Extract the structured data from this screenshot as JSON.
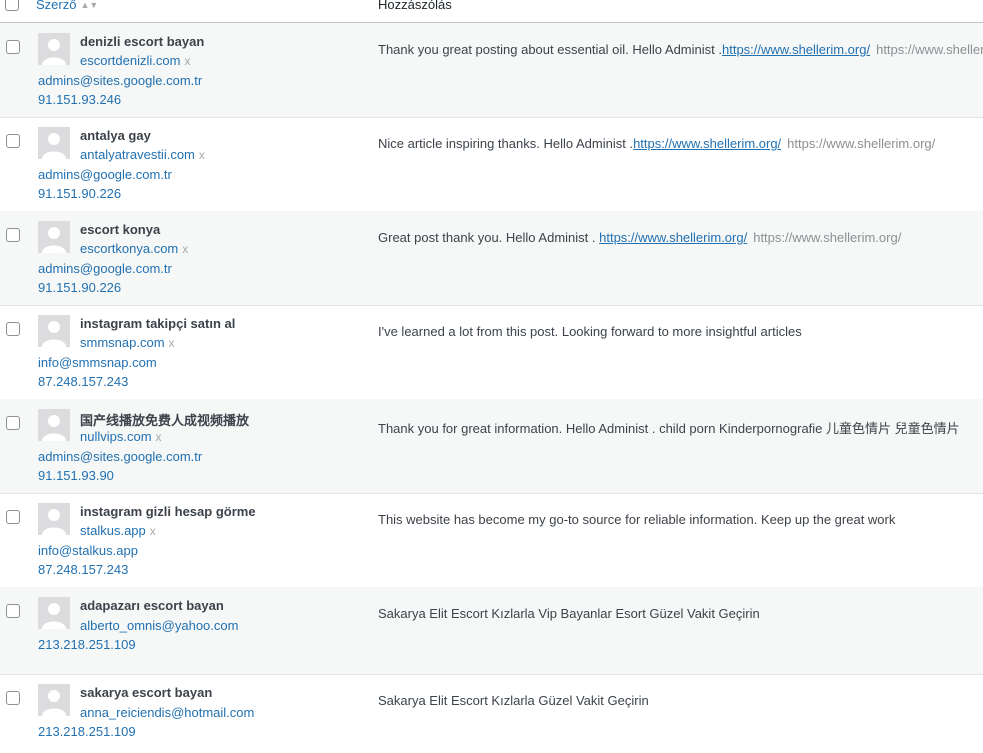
{
  "header": {
    "author_label": "Szerző",
    "comment_label": "Hozzászólás"
  },
  "icons": {
    "sort": "sort-arrows-icon",
    "avatar": "default-avatar-icon",
    "remove": "x"
  },
  "comments": [
    {
      "author": "denizli escort bayan",
      "site": "escortdenizli.com",
      "email": "admins@sites.google.com.tr",
      "ip": "91.151.93.246",
      "text": "Thank you great posting about essential oil. Hello Administ .",
      "link": "https://www.shellerim.org/",
      "plain_url": "https://www.shellerim.org/"
    },
    {
      "author": "antalya gay",
      "site": "antalyatravestii.com",
      "email": "admins@google.com.tr",
      "ip": "91.151.90.226",
      "text": "Nice article inspiring thanks. Hello Administ .",
      "link": "https://www.shellerim.org/",
      "plain_url": "https://www.shellerim.org/"
    },
    {
      "author": "escort konya",
      "site": "escortkonya.com",
      "email": "admins@google.com.tr",
      "ip": "91.151.90.226",
      "text": "Great post thank you. Hello Administ . ",
      "link": "https://www.shellerim.org/",
      "plain_url": "https://www.shellerim.org/"
    },
    {
      "author": "instagram takipçi satın al",
      "site": "smmsnap.com",
      "email": "info@smmsnap.com",
      "ip": "87.248.157.243",
      "text": "I've learned a lot from this post. Looking forward to more insightful articles"
    },
    {
      "author": "国产线播放免费人成视频播放",
      "site": "nullvips.com",
      "email": "admins@sites.google.com.tr",
      "ip": "91.151.93.90",
      "text": "Thank you for great information. Hello Administ . child porn Kinderpornografie 儿童色情片 兒童色情片"
    },
    {
      "author": "instagram gizli hesap görme",
      "site": "stalkus.app",
      "email": "info@stalkus.app",
      "ip": "87.248.157.243",
      "text": "This website has become my go-to source for reliable information. Keep up the great work"
    },
    {
      "author": "adapazarı escort bayan",
      "email": "alberto_omnis@yahoo.com",
      "ip": "213.218.251.109",
      "text": "Sakarya Elit Escort Kızlarla Vip Bayanlar Esort Güzel Vakit Geçirin"
    },
    {
      "author": "sakarya escort bayan",
      "email": "anna_reiciendis@hotmail.com",
      "ip": "213.218.251.109",
      "text": "Sakarya Elit Escort Kızlarla Güzel Vakit Geçirin"
    }
  ]
}
